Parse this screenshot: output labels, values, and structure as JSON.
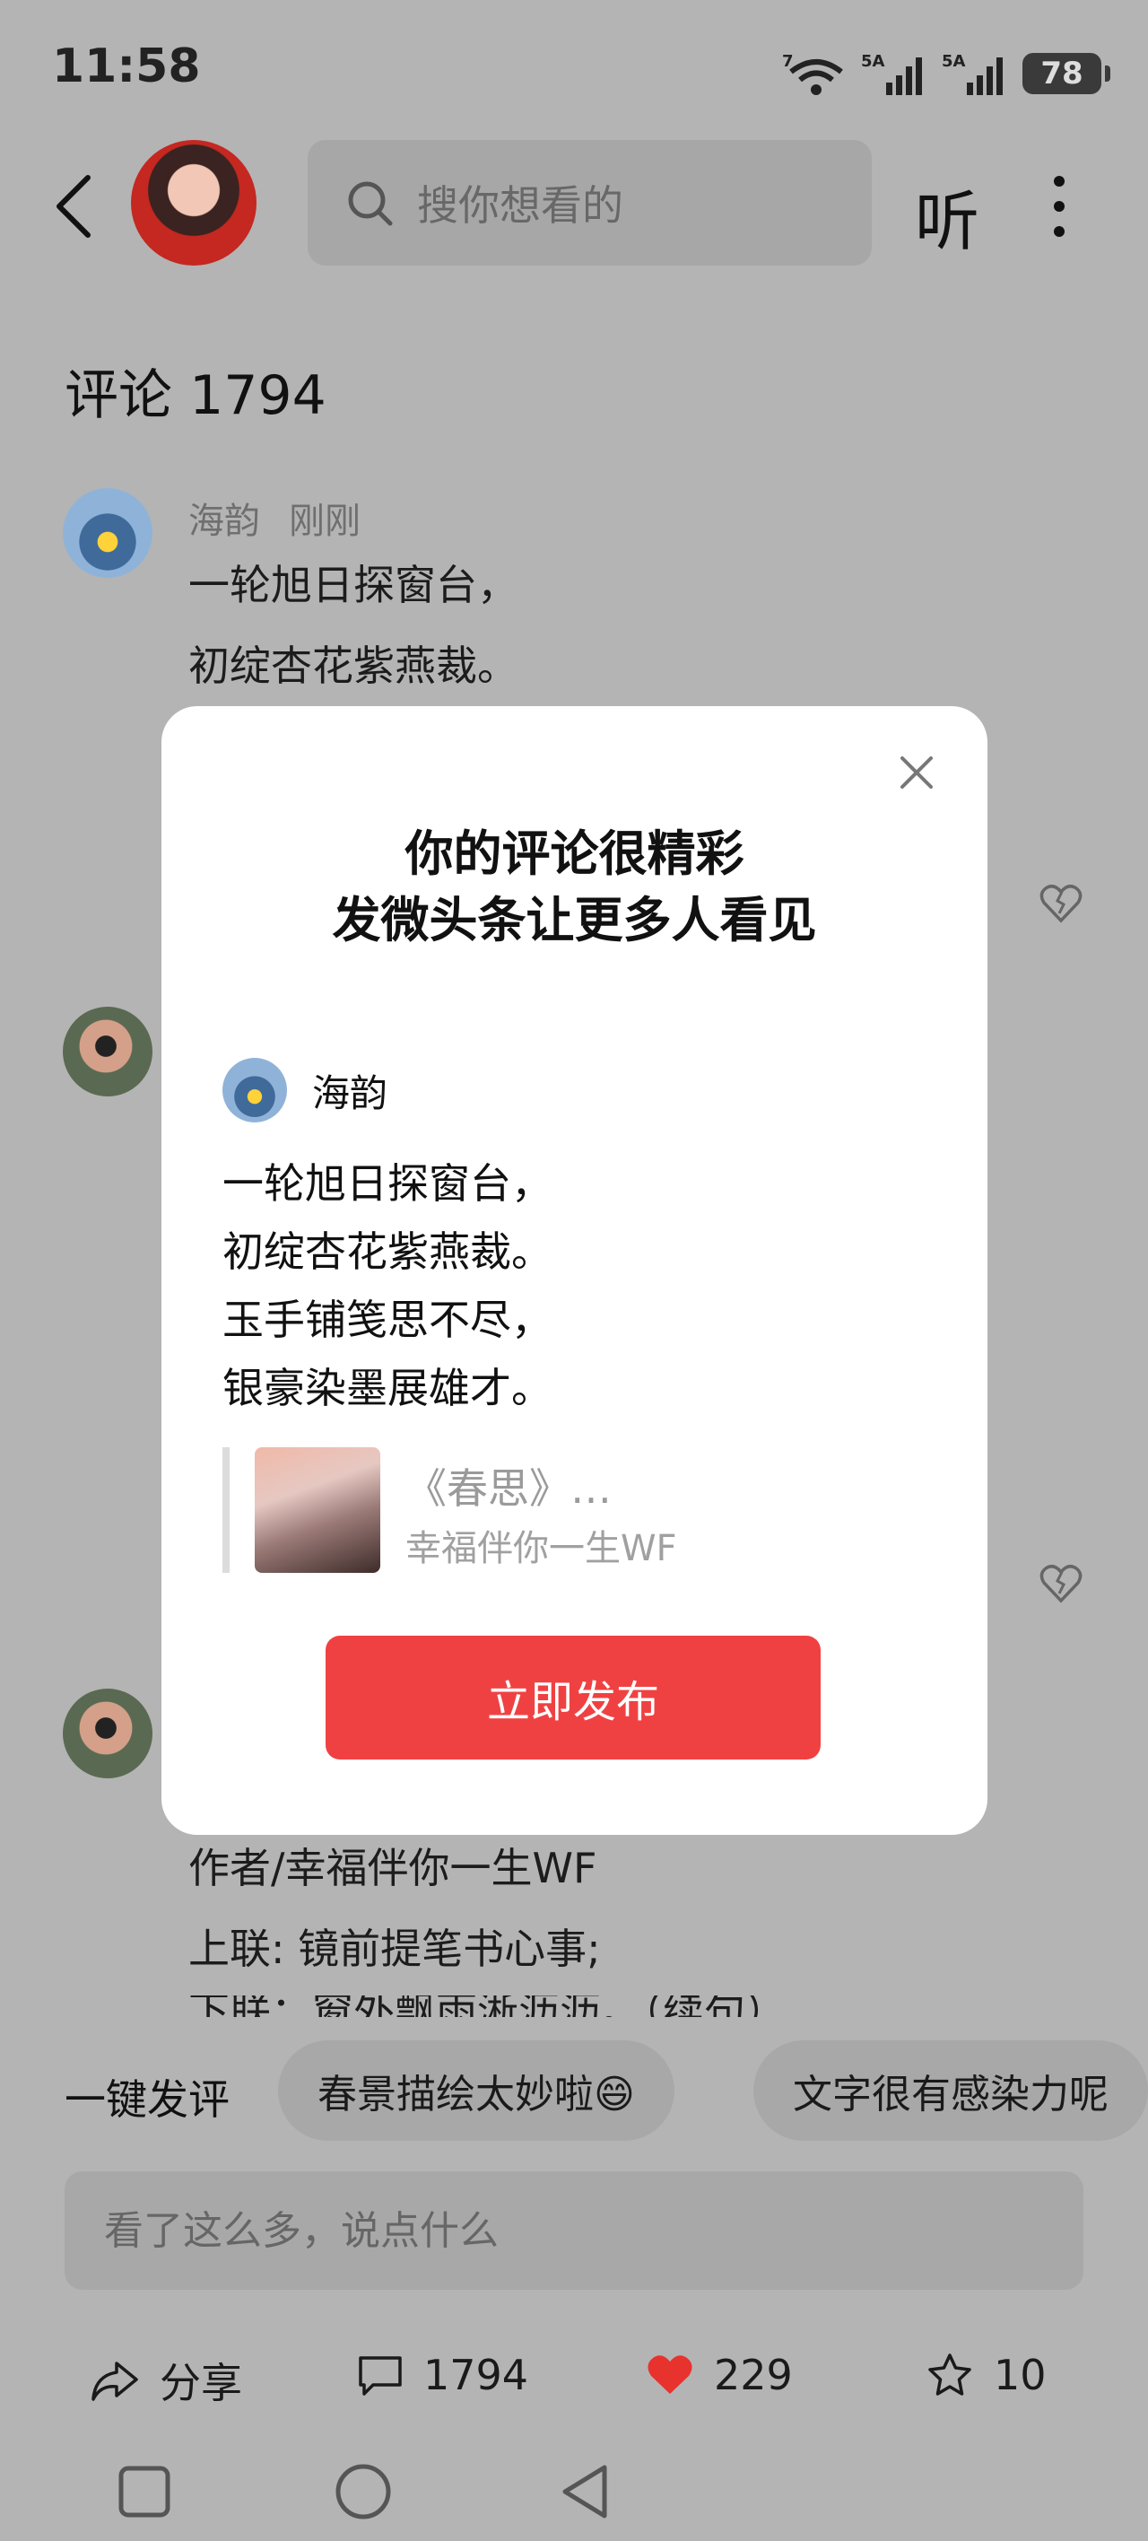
{
  "status_bar": {
    "time": "11:58",
    "wifi_label": "7",
    "sim1_label": "5A",
    "sim2_label": "5A",
    "battery": "78"
  },
  "header": {
    "back_icon": "chevron-left-icon",
    "search_placeholder": "搜你想看的",
    "listen_label": "听",
    "more_icon": "more-vertical-icon"
  },
  "comments": {
    "title": "评论 1794",
    "items": [
      {
        "author": "海韵",
        "time": "刚刚",
        "lines": [
          "一轮旭日探窗台，",
          "初绽杏花紫燕裁。"
        ]
      }
    ],
    "partial_lines": [
      "作者/幸福伴你一生WF",
      "上联: 镜前提笔书心事;",
      "下联：窗外飘雨淅沥沥。（续句）"
    ]
  },
  "quick_reply": {
    "label": "一键发评",
    "chips": [
      "春景描绘太妙啦😄",
      "文字很有感染力呢"
    ]
  },
  "comment_input": {
    "placeholder": "看了这么多，说点什么"
  },
  "bottom_actions": {
    "share_label": "分享",
    "comment_count": "1794",
    "like_count": "229",
    "favorite_count": "10",
    "like_color": "#e8322e"
  },
  "modal": {
    "title_line1": "你的评论很精彩",
    "title_line2": "发微头条让更多人看见",
    "author": "海韵",
    "lines": [
      "一轮旭日探窗台，",
      "初绽杏花紫燕裁。",
      "玉手铺笺思不尽，",
      "银豪染墨展雄才。"
    ],
    "quote_title": "《春思》…",
    "quote_author": "幸福伴你一生WF",
    "publish_label": "立即发布",
    "publish_color": "#f04142"
  }
}
